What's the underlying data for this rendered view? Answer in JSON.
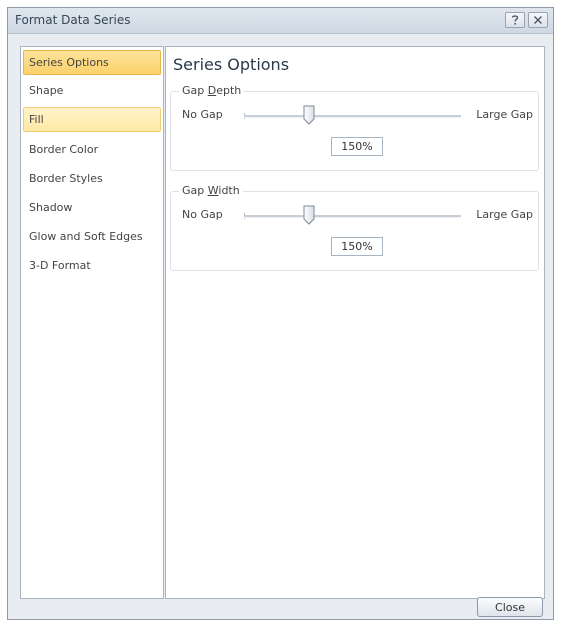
{
  "window": {
    "title": "Format Data Series",
    "help_icon": "question-mark-icon",
    "close_icon": "close-x-icon"
  },
  "sidebar": {
    "items": [
      {
        "label": "Series Options",
        "state": "selected"
      },
      {
        "label": "Shape",
        "state": "normal"
      },
      {
        "label": "Fill",
        "state": "hover"
      },
      {
        "label": "Border Color",
        "state": "normal"
      },
      {
        "label": "Border Styles",
        "state": "normal"
      },
      {
        "label": "Shadow",
        "state": "normal"
      },
      {
        "label": "Glow and Soft Edges",
        "state": "normal"
      },
      {
        "label": "3-D Format",
        "state": "normal"
      }
    ]
  },
  "main": {
    "title": "Series Options",
    "gap_depth": {
      "label_prefix": "Gap ",
      "label_mnemonic": "D",
      "label_suffix": "epth",
      "min_label": "No Gap",
      "max_label": "Large Gap",
      "value_text": "150%",
      "slider_fraction": 0.3
    },
    "gap_width": {
      "label_prefix": "Gap ",
      "label_mnemonic": "W",
      "label_suffix": "idth",
      "min_label": "No Gap",
      "max_label": "Large Gap",
      "value_text": "150%",
      "slider_fraction": 0.3
    }
  },
  "footer": {
    "close_label": "Close"
  },
  "colors": {
    "selected_bg": "#fbd16a",
    "hover_bg": "#ffe9a6",
    "title_text": "#2a3a4a"
  }
}
